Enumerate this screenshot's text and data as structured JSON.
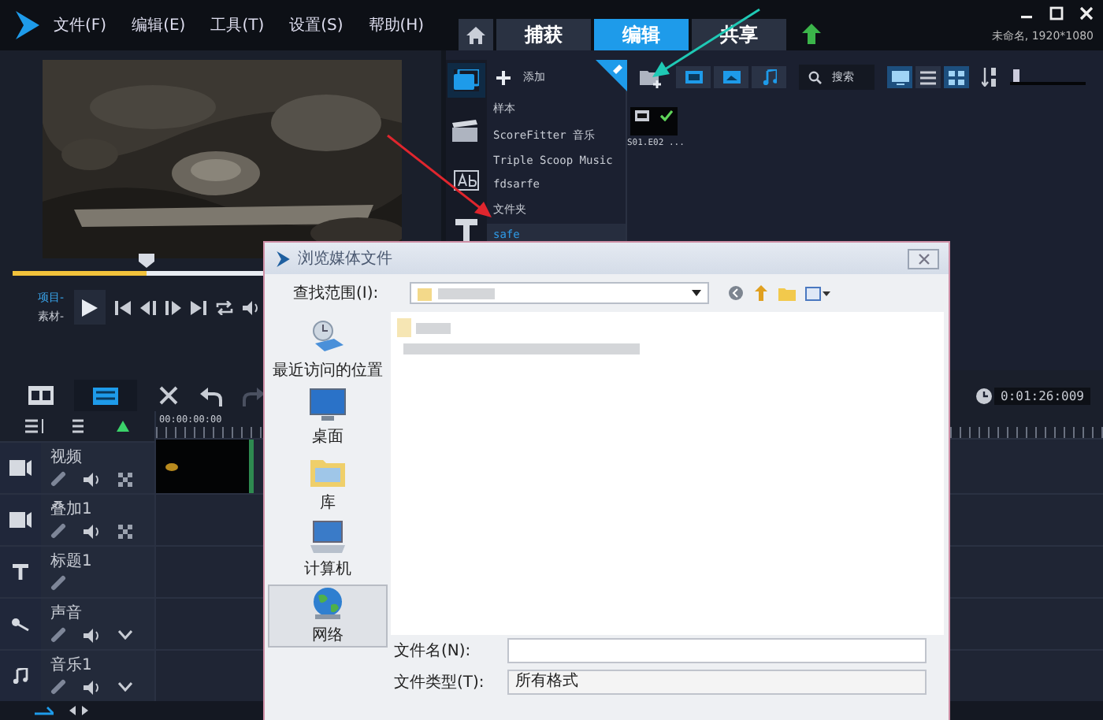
{
  "menu": [
    "文件(F)",
    "编辑(E)",
    "工具(T)",
    "设置(S)",
    "帮助(H)"
  ],
  "tabs": [
    {
      "label": "捕获",
      "selected": false
    },
    {
      "label": "编辑",
      "selected": true
    },
    {
      "label": "共享",
      "selected": false
    }
  ],
  "project_info": "未命名, 1920*1080",
  "player": {
    "mode_labels": [
      "项目-",
      "素材-"
    ],
    "level": 0.32
  },
  "library": {
    "add_label": "添加",
    "search_label": "搜索",
    "folders": [
      {
        "label": "样本",
        "selected": false
      },
      {
        "label": "ScoreFitter 音乐",
        "selected": false
      },
      {
        "label": "Triple Scoop Music",
        "selected": false
      },
      {
        "label": "fdsarfe",
        "selected": false
      },
      {
        "label": "文件夹",
        "selected": false
      },
      {
        "label": "safe",
        "selected": true
      }
    ],
    "clips": [
      {
        "label": "S01.E02 ...",
        "checked": true
      }
    ],
    "zoom_slider": {
      "level": 0.05
    }
  },
  "timeline": {
    "ruler_start": "00:00:00:00",
    "timecode": "0:01:26:009",
    "tracks": [
      {
        "name": "视频",
        "kind": "video"
      },
      {
        "name": "叠加1",
        "kind": "overlay"
      },
      {
        "name": "标题1",
        "kind": "title"
      },
      {
        "name": "声音",
        "kind": "voice"
      },
      {
        "name": "音乐1",
        "kind": "music"
      }
    ]
  },
  "dialog": {
    "title": "浏览媒体文件",
    "look_in_label": "查找范围(I):",
    "places": [
      {
        "label": "最近访问的位置",
        "kind": "recent",
        "selected": false
      },
      {
        "label": "桌面",
        "kind": "desktop",
        "selected": false
      },
      {
        "label": "库",
        "kind": "library",
        "selected": false
      },
      {
        "label": "计算机",
        "kind": "computer",
        "selected": false
      },
      {
        "label": "网络",
        "kind": "network",
        "selected": true
      }
    ],
    "file_name_label": "文件名(N):",
    "file_type_label": "文件类型(T):",
    "file_type_value": "所有格式"
  }
}
